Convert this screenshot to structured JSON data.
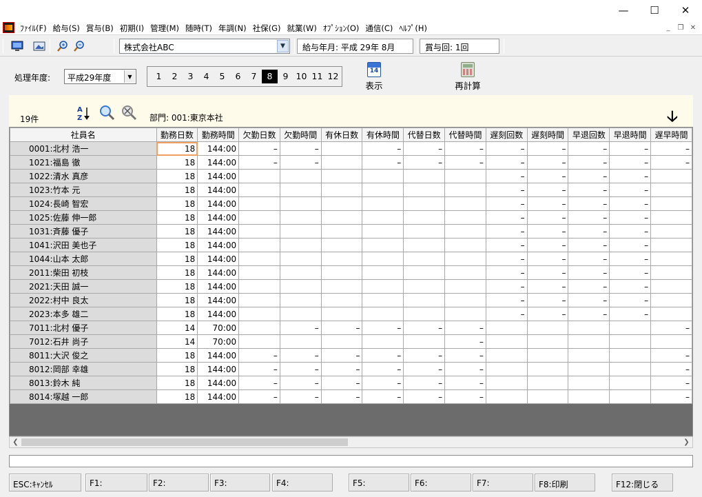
{
  "menu": [
    "ﾌｧｲﾙ(F)",
    "給与(S)",
    "賞与(B)",
    "初期(I)",
    "管理(M)",
    "随時(T)",
    "年調(N)",
    "社保(G)",
    "就業(W)",
    "ｵﾌﾟｼｮﾝ(O)",
    "通信(C)",
    "ﾍﾙﾌﾟ(H)"
  ],
  "toolbar": {
    "company": "株式会社ABC",
    "pay_month": "給与年月: 平成 29年  8月",
    "bonus_round": "賞与回: 1回"
  },
  "period": {
    "label": "処理年度:",
    "year": "平成29年度",
    "months": [
      "1",
      "2",
      "3",
      "4",
      "5",
      "6",
      "7",
      "8",
      "9",
      "10",
      "11",
      "12"
    ],
    "selected_month": "8"
  },
  "actions": {
    "display": "表示",
    "recalc": "再計算",
    "calendar_day": "14"
  },
  "info": {
    "count": "19件",
    "department": "部門:  001:東京本社"
  },
  "grid": {
    "columns": [
      "社員名",
      "勤務日数",
      "勤務時間",
      "欠勤日数",
      "欠勤時間",
      "有休日数",
      "有休時間",
      "代替日数",
      "代替時間",
      "遅刻回数",
      "遅刻時間",
      "早退回数",
      "早退時間",
      "遅早時間"
    ],
    "rows": [
      [
        "0001:北村  浩一",
        "18",
        "144:00",
        "–",
        "–",
        "",
        "–",
        "–",
        "–",
        "–",
        "–",
        "–",
        "–",
        "–"
      ],
      [
        "1021:福島  徹",
        "18",
        "144:00",
        "–",
        "–",
        "",
        "–",
        "–",
        "–",
        "–",
        "–",
        "–",
        "–",
        "–"
      ],
      [
        "1022:清水  真彦",
        "18",
        "144:00",
        "",
        "",
        "",
        "",
        "",
        "",
        "–",
        "–",
        "–",
        "–",
        ""
      ],
      [
        "1023:竹本  元",
        "18",
        "144:00",
        "",
        "",
        "",
        "",
        "",
        "",
        "–",
        "–",
        "–",
        "–",
        ""
      ],
      [
        "1024:長崎  智宏",
        "18",
        "144:00",
        "",
        "",
        "",
        "",
        "",
        "",
        "–",
        "–",
        "–",
        "–",
        ""
      ],
      [
        "1025:佐藤  伸一郎",
        "18",
        "144:00",
        "",
        "",
        "",
        "",
        "",
        "",
        "–",
        "–",
        "–",
        "–",
        ""
      ],
      [
        "1031:斉藤  優子",
        "18",
        "144:00",
        "",
        "",
        "",
        "",
        "",
        "",
        "–",
        "–",
        "–",
        "–",
        ""
      ],
      [
        "1041:沢田  美也子",
        "18",
        "144:00",
        "",
        "",
        "",
        "",
        "",
        "",
        "–",
        "–",
        "–",
        "–",
        ""
      ],
      [
        "1044:山本  太郎",
        "18",
        "144:00",
        "",
        "",
        "",
        "",
        "",
        "",
        "–",
        "–",
        "–",
        "–",
        ""
      ],
      [
        "2011:柴田  初枝",
        "18",
        "144:00",
        "",
        "",
        "",
        "",
        "",
        "",
        "–",
        "–",
        "–",
        "–",
        ""
      ],
      [
        "2021:天田  誠一",
        "18",
        "144:00",
        "",
        "",
        "",
        "",
        "",
        "",
        "–",
        "–",
        "–",
        "–",
        ""
      ],
      [
        "2022:村中  良太",
        "18",
        "144:00",
        "",
        "",
        "",
        "",
        "",
        "",
        "–",
        "–",
        "–",
        "–",
        ""
      ],
      [
        "2023:本多  雄二",
        "18",
        "144:00",
        "",
        "",
        "",
        "",
        "",
        "",
        "–",
        "–",
        "–",
        "–",
        ""
      ],
      [
        "7011:北村  優子",
        "14",
        "70:00",
        "",
        "–",
        "–",
        "–",
        "–",
        "–",
        "",
        "",
        "",
        "",
        "–"
      ],
      [
        "7012:石井  尚子",
        "14",
        "70:00",
        "",
        "",
        "",
        "",
        "",
        "–",
        "",
        "",
        "",
        "",
        ""
      ],
      [
        "8011:大沢  俊之",
        "18",
        "144:00",
        "–",
        "–",
        "–",
        "–",
        "–",
        "–",
        "",
        "",
        "",
        "",
        "–"
      ],
      [
        "8012:岡部  幸雄",
        "18",
        "144:00",
        "–",
        "–",
        "–",
        "–",
        "–",
        "–",
        "",
        "",
        "",
        "",
        "–"
      ],
      [
        "8013:鈴木  純",
        "18",
        "144:00",
        "–",
        "–",
        "–",
        "–",
        "–",
        "–",
        "",
        "",
        "",
        "",
        "–"
      ],
      [
        "8014:塚越  一郎",
        "18",
        "144:00",
        "–",
        "–",
        "–",
        "–",
        "–",
        "–",
        "",
        "",
        "",
        "",
        "–"
      ]
    ]
  },
  "fkeys": [
    {
      "key": "esc",
      "label": "ESC:ｷｬﾝｾﾙ"
    },
    {
      "key": "f1",
      "label": "F1:"
    },
    {
      "key": "f2",
      "label": "F2:"
    },
    {
      "key": "f3",
      "label": "F3:"
    },
    {
      "key": "f4",
      "label": "F4:"
    },
    {
      "key": "f5",
      "label": "F5:"
    },
    {
      "key": "f6",
      "label": "F6:"
    },
    {
      "key": "f7",
      "label": "F7:"
    },
    {
      "key": "f8",
      "label": "F8:印刷"
    },
    {
      "key": "f12",
      "label": "F12:閉じる"
    }
  ]
}
